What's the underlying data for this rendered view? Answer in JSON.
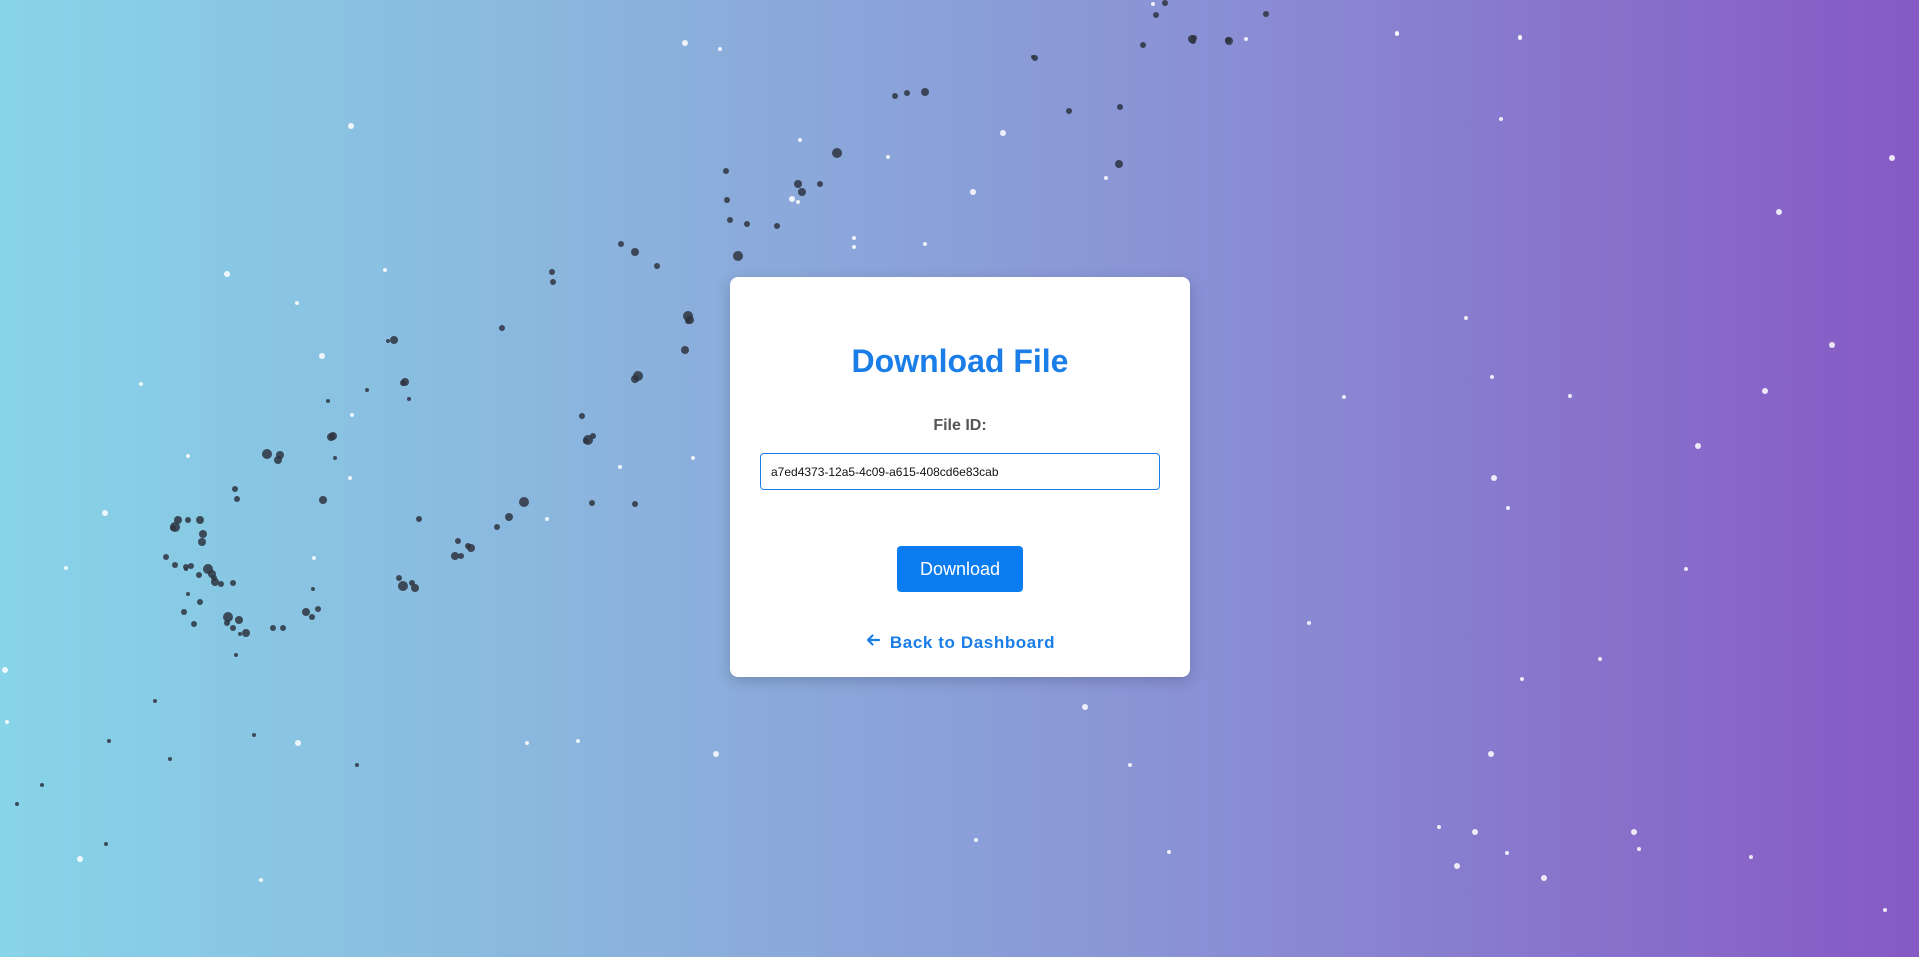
{
  "page": {
    "title": "Download File"
  },
  "form": {
    "file_id_label": "File ID:",
    "file_id_value": "a7ed4373-12a5-4c09-a615-408cd6e83cab"
  },
  "actions": {
    "download_label": "Download",
    "back_label": "Back to Dashboard",
    "back_icon": "arrow-left-icon"
  },
  "colors": {
    "accent": "#0b7cf0",
    "gradient_start": "#88d4e8",
    "gradient_end": "#8659c4"
  }
}
